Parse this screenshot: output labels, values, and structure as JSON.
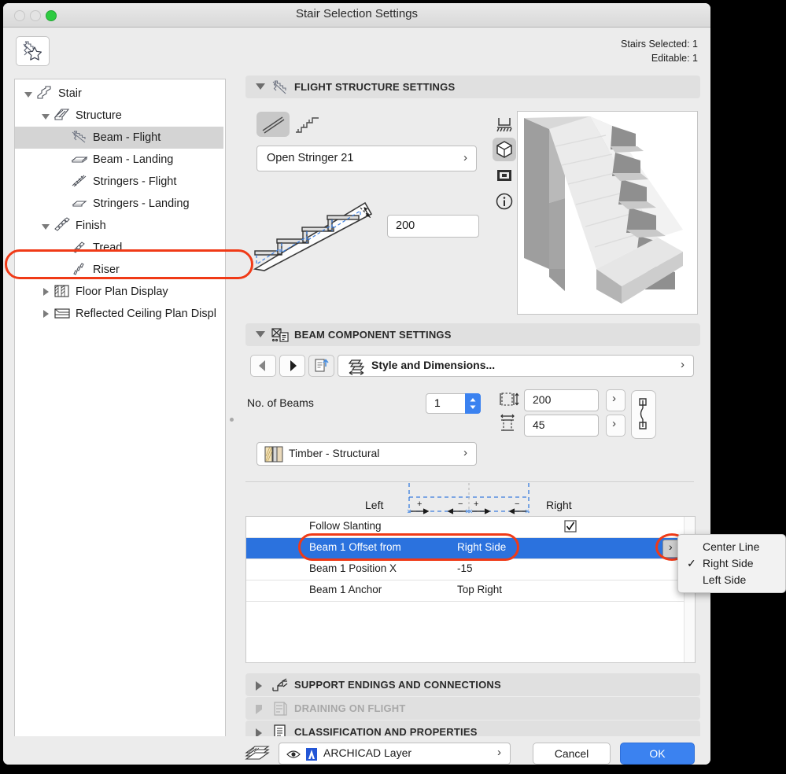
{
  "window": {
    "title": "Stair Selection Settings",
    "traffic_lights": [
      "close",
      "minimize",
      "zoom"
    ],
    "favorites_icon": "stair-favorite-icon",
    "selection_info": {
      "selected": "Stairs Selected: 1",
      "editable": "Editable: 1"
    }
  },
  "sidebar": {
    "items": [
      {
        "label": "Stair",
        "icon": "stair-icon",
        "depth": 0,
        "twisty": "down",
        "selected": false
      },
      {
        "label": "Structure",
        "icon": "structure-icon",
        "depth": 1,
        "twisty": "down",
        "selected": false
      },
      {
        "label": "Beam - Flight",
        "icon": "beam-flight-icon",
        "depth": 2,
        "twisty": "none",
        "selected": true
      },
      {
        "label": "Beam - Landing",
        "icon": "beam-landing-icon",
        "depth": 2,
        "twisty": "none",
        "selected": false
      },
      {
        "label": "Stringers - Flight",
        "icon": "stringers-flight-icon",
        "depth": 2,
        "twisty": "none",
        "selected": false
      },
      {
        "label": "Stringers - Landing",
        "icon": "stringers-landing-icon",
        "depth": 2,
        "twisty": "none",
        "selected": false
      },
      {
        "label": "Finish",
        "icon": "finish-icon",
        "depth": 1,
        "twisty": "down",
        "selected": false
      },
      {
        "label": "Tread",
        "icon": "tread-icon",
        "depth": 2,
        "twisty": "none",
        "selected": false
      },
      {
        "label": "Riser",
        "icon": "riser-icon",
        "depth": 2,
        "twisty": "none",
        "selected": false
      },
      {
        "label": "Floor Plan Display",
        "icon": "floor-plan-icon",
        "depth": 1,
        "twisty": "right",
        "selected": false
      },
      {
        "label": "Reflected Ceiling Plan Displ",
        "icon": "ceiling-plan-icon",
        "depth": 1,
        "twisty": "right",
        "selected": false
      }
    ]
  },
  "flight_structure": {
    "header": "FLIGHT STRUCTURE SETTINGS",
    "header_icon": "beam-flight-icon",
    "type_toggle": [
      {
        "name": "monolith-mode",
        "selected": true
      },
      {
        "name": "stepped-mode",
        "selected": false
      }
    ],
    "structure_value": "Open Stringer 21",
    "thickness_value": "200",
    "preview_icons": [
      {
        "name": "section-view-icon",
        "selected": false
      },
      {
        "name": "3d-view-icon",
        "selected": true
      },
      {
        "name": "elevation-view-icon",
        "selected": false
      },
      {
        "name": "info-icon",
        "selected": false
      }
    ],
    "preview_name": "stair-3d-preview"
  },
  "beam_component": {
    "header": "BEAM COMPONENT SETTINGS",
    "header_icon": "beam-component-icon",
    "nav": {
      "prev": "previous-component",
      "next": "next-component",
      "edit": "edit-component"
    },
    "style_button": "Style and Dimensions...",
    "no_of_beams_label": "No. of Beams",
    "no_of_beams_value": "1",
    "width_value": "200",
    "height_value": "45",
    "link_icon": "link-dimensions-icon",
    "material_value": "Timber - Structural",
    "col_left": "Left",
    "col_right": "Right",
    "table_rows": [
      {
        "key": "Follow Slanting",
        "value": "",
        "checkbox": true,
        "selected": false
      },
      {
        "key": "Beam 1 Offset from",
        "value": "Right Side",
        "checkbox": false,
        "selected": true
      },
      {
        "key": "Beam 1 Position X",
        "value": "-15",
        "checkbox": false,
        "selected": false
      },
      {
        "key": "Beam 1 Anchor",
        "value": "Top Right",
        "checkbox": false,
        "selected": false
      }
    ],
    "dropdown": {
      "options": [
        "Center Line",
        "Right Side",
        "Left Side"
      ],
      "checked": "Right Side"
    }
  },
  "collapsed_sections": [
    {
      "label": "SUPPORT ENDINGS AND CONNECTIONS",
      "icon": "support-endings-icon",
      "disabled": false
    },
    {
      "label": "DRAINING ON FLIGHT",
      "icon": "draining-icon",
      "disabled": true
    },
    {
      "label": "CLASSIFICATION AND PROPERTIES",
      "icon": "classification-icon",
      "disabled": false
    }
  ],
  "footer": {
    "layers_icon": "layers-icon",
    "eye_icon": "visibility-eye-icon",
    "layer_icon": "archicad-layer-icon",
    "layer_value": "ARCHICAD Layer",
    "cancel": "Cancel",
    "ok": "OK"
  },
  "colors": {
    "accent_blue": "#2b72de",
    "ok_blue": "#3b82f0",
    "highlight_red": "#f03a17",
    "window_bg": "#ececec",
    "section_bg": "#e0e0e0"
  }
}
